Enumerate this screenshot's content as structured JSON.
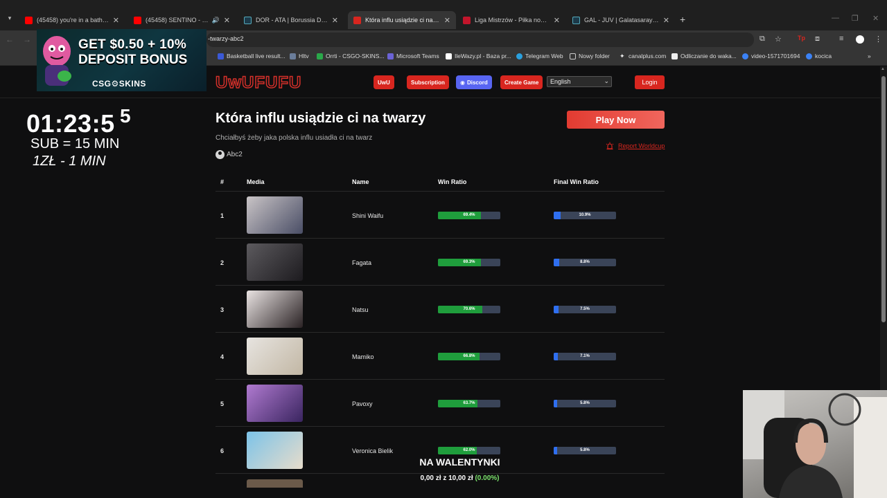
{
  "browser": {
    "tabs": [
      {
        "title": "(45458) you're in a bathroom at",
        "favicon_color": "#ff0000"
      },
      {
        "title": "(45458) SENTINO - CASABLA",
        "favicon_color": "#ff0000"
      },
      {
        "title": "DOR - ATA | Borussia Dortmund",
        "favicon_color": "#1c3a4a"
      },
      {
        "title": "Która influ usiądzie ci na twarzy",
        "favicon_color": "#d8261f"
      },
      {
        "title": "Liga Mistrzów - Piłka nożna : le",
        "favicon_color": "#c2152b"
      },
      {
        "title": "GAL - JUV | Galatasaray - Juven",
        "favicon_color": "#1c3a4a"
      }
    ],
    "url": "-twarzy-abc2",
    "bookmarks": [
      {
        "label": "Basketball live result...",
        "color": "#3b59d6"
      },
      {
        "label": "Hltv",
        "color": "#6a7d9a"
      },
      {
        "label": "Orrti - CSGO-SKINS...",
        "color": "#2aa84a"
      },
      {
        "label": "Microsoft Teams",
        "color": "#6b63d6"
      },
      {
        "label": "IleWazy.pl - Baza pr...",
        "color": "#ffffff"
      },
      {
        "label": "Telegram Web",
        "color": "#2aa0de"
      },
      {
        "label": "Nowy folder",
        "color": "#cccccc"
      },
      {
        "label": "canalplus.com",
        "color": "#eeeeee"
      },
      {
        "label": "Odliczanie do waka...",
        "color": "#eeeeee"
      },
      {
        "label": "video-1571701694",
        "color": "#3b82f6"
      },
      {
        "label": "kocica",
        "color": "#3b82f6"
      }
    ],
    "icons": {
      "tab_menu": "▾",
      "new_tab": "+",
      "close": "✕",
      "audio": "🔊",
      "back": "←",
      "forward": "→",
      "apps": "⊞",
      "bookmarks_more": "»",
      "translate": "⧉",
      "star": "☆",
      "extension": "⧈",
      "menu": "⋮"
    }
  },
  "overlay": {
    "ad": {
      "line1": "GET $0.50 + 10%",
      "line2": "DEPOSIT BONUS",
      "brand": "CSG⚙SKINS"
    },
    "timer": "01:23:5",
    "timer_sup": "5",
    "sub_rule": "SUB = 15 MIN",
    "price_rule": "1ZŁ - 1 MIN",
    "donation": {
      "title": "NA WALENTYNKI",
      "amount": "0,00 zł z 10,00 zł",
      "percent": "(0.00%)"
    }
  },
  "site": {
    "logo": "UwUFUFU",
    "nav": {
      "uwu": "UwU",
      "subscription": "Subscription",
      "discord": "Discord",
      "create_game": "Create Game",
      "language": "English",
      "login": "Login"
    },
    "title": "Która influ usiądzie ci na twarzy",
    "description": "Chciałbyś żeby jaka polska influ usiadła ci na twarz",
    "author": "Abc2",
    "play_now": "Play Now",
    "report": "Report Worldcup",
    "table": {
      "headers": {
        "rank": "#",
        "media": "Media",
        "name": "Name",
        "win": "Win Ratio",
        "final": "Final Win Ratio"
      },
      "rows": [
        {
          "rank": "1",
          "name": "Shini Waifu",
          "win": 69.4,
          "win_label": "69.4%",
          "final": 10.9,
          "final_label": "10.9%",
          "thumb": [
            "#c9c4c6",
            "#4a4e66"
          ]
        },
        {
          "rank": "2",
          "name": "Fagata",
          "win": 69.3,
          "win_label": "69.3%",
          "final": 8.8,
          "final_label": "8.8%",
          "thumb": [
            "#5c5a5e",
            "#1d1b1f"
          ]
        },
        {
          "rank": "3",
          "name": "Natsu",
          "win": 70.6,
          "win_label": "70.6%",
          "final": 7.5,
          "final_label": "7.5%",
          "thumb": [
            "#e9e3e2",
            "#2a2224"
          ]
        },
        {
          "rank": "4",
          "name": "Mamiko",
          "win": 66.8,
          "win_label": "66.8%",
          "final": 7.1,
          "final_label": "7.1%",
          "thumb": [
            "#e7e4e0",
            "#c2b7a4"
          ]
        },
        {
          "rank": "5",
          "name": "Pavoxy",
          "win": 63.7,
          "win_label": "63.7%",
          "final": 5.8,
          "final_label": "5.8%",
          "thumb": [
            "#b07ad0",
            "#3a2560"
          ]
        },
        {
          "rank": "6",
          "name": "Veronica Bielik",
          "win": 62.0,
          "win_label": "62.0%",
          "final": 5.8,
          "final_label": "5.8%",
          "thumb": [
            "#7cc3e8",
            "#e7dccb"
          ]
        }
      ]
    }
  }
}
